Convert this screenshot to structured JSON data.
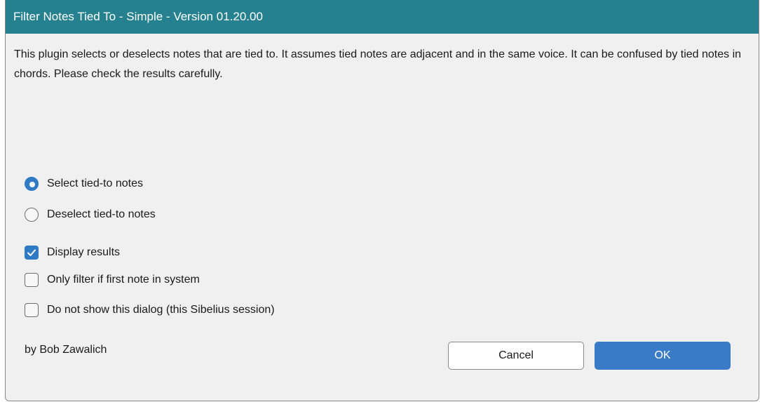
{
  "window": {
    "title": "Filter Notes Tied To - Simple - Version 01.20.00"
  },
  "description": "This plugin selects or deselects notes that are tied to. It assumes tied notes are adjacent and in the same voice. It can be confused by tied notes in chords. Please check the results carefully.",
  "radios": [
    {
      "label": "Select tied-to notes",
      "checked": true
    },
    {
      "label": "Deselect tied-to notes",
      "checked": false
    }
  ],
  "checkboxes": [
    {
      "label": "Display results",
      "checked": true
    },
    {
      "label": "Only filter if first note in system",
      "checked": false
    },
    {
      "label": "Do not show this dialog (this Sibelius session)",
      "checked": false
    }
  ],
  "author": "by Bob Zawalich",
  "buttons": {
    "cancel_label": "Cancel",
    "ok_label": "OK"
  },
  "colors": {
    "titlebar": "#25818f",
    "accent": "#2f7ac4",
    "ok_button": "#3a7bc8",
    "dialog_background": "#f0f0f0"
  }
}
